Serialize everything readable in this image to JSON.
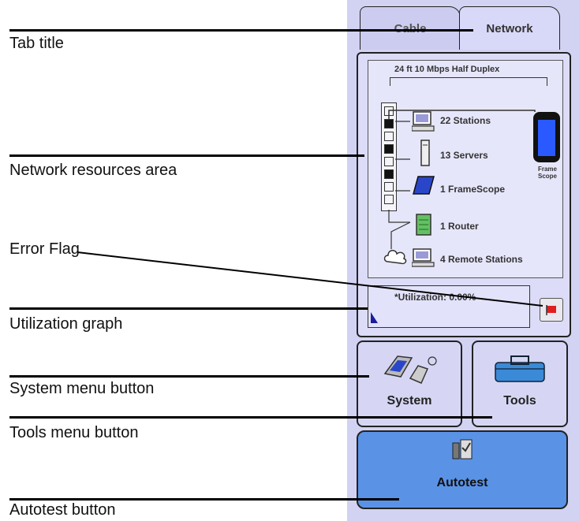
{
  "callouts": {
    "tab_title": "Tab title",
    "network_resources_area": "Network resources area",
    "error_flag": "Error Flag",
    "utilization_graph": "Utilization graph",
    "system_menu_button": "System menu button",
    "tools_menu_button": "Tools menu button",
    "autotest_button": "Autotest button"
  },
  "device": {
    "tabs": {
      "cable": "Cable",
      "network": "Network"
    },
    "header": "24 ft  10 Mbps Half Duplex",
    "resources": {
      "stations": "22 Stations",
      "servers": "13 Servers",
      "framescope": "1 FrameScope",
      "router": "1 Router",
      "remote": "4 Remote Stations"
    },
    "framescope_label": "Frame Scope",
    "framescope_side": "Frame Scope",
    "utilization": "*Utilization: 0.00%",
    "buttons": {
      "system": "System",
      "tools": "Tools",
      "autotest": "Autotest"
    },
    "colors": {
      "panel": "#d2d2f2",
      "autotest": "#5a93e6",
      "flag": "#e02020"
    }
  }
}
